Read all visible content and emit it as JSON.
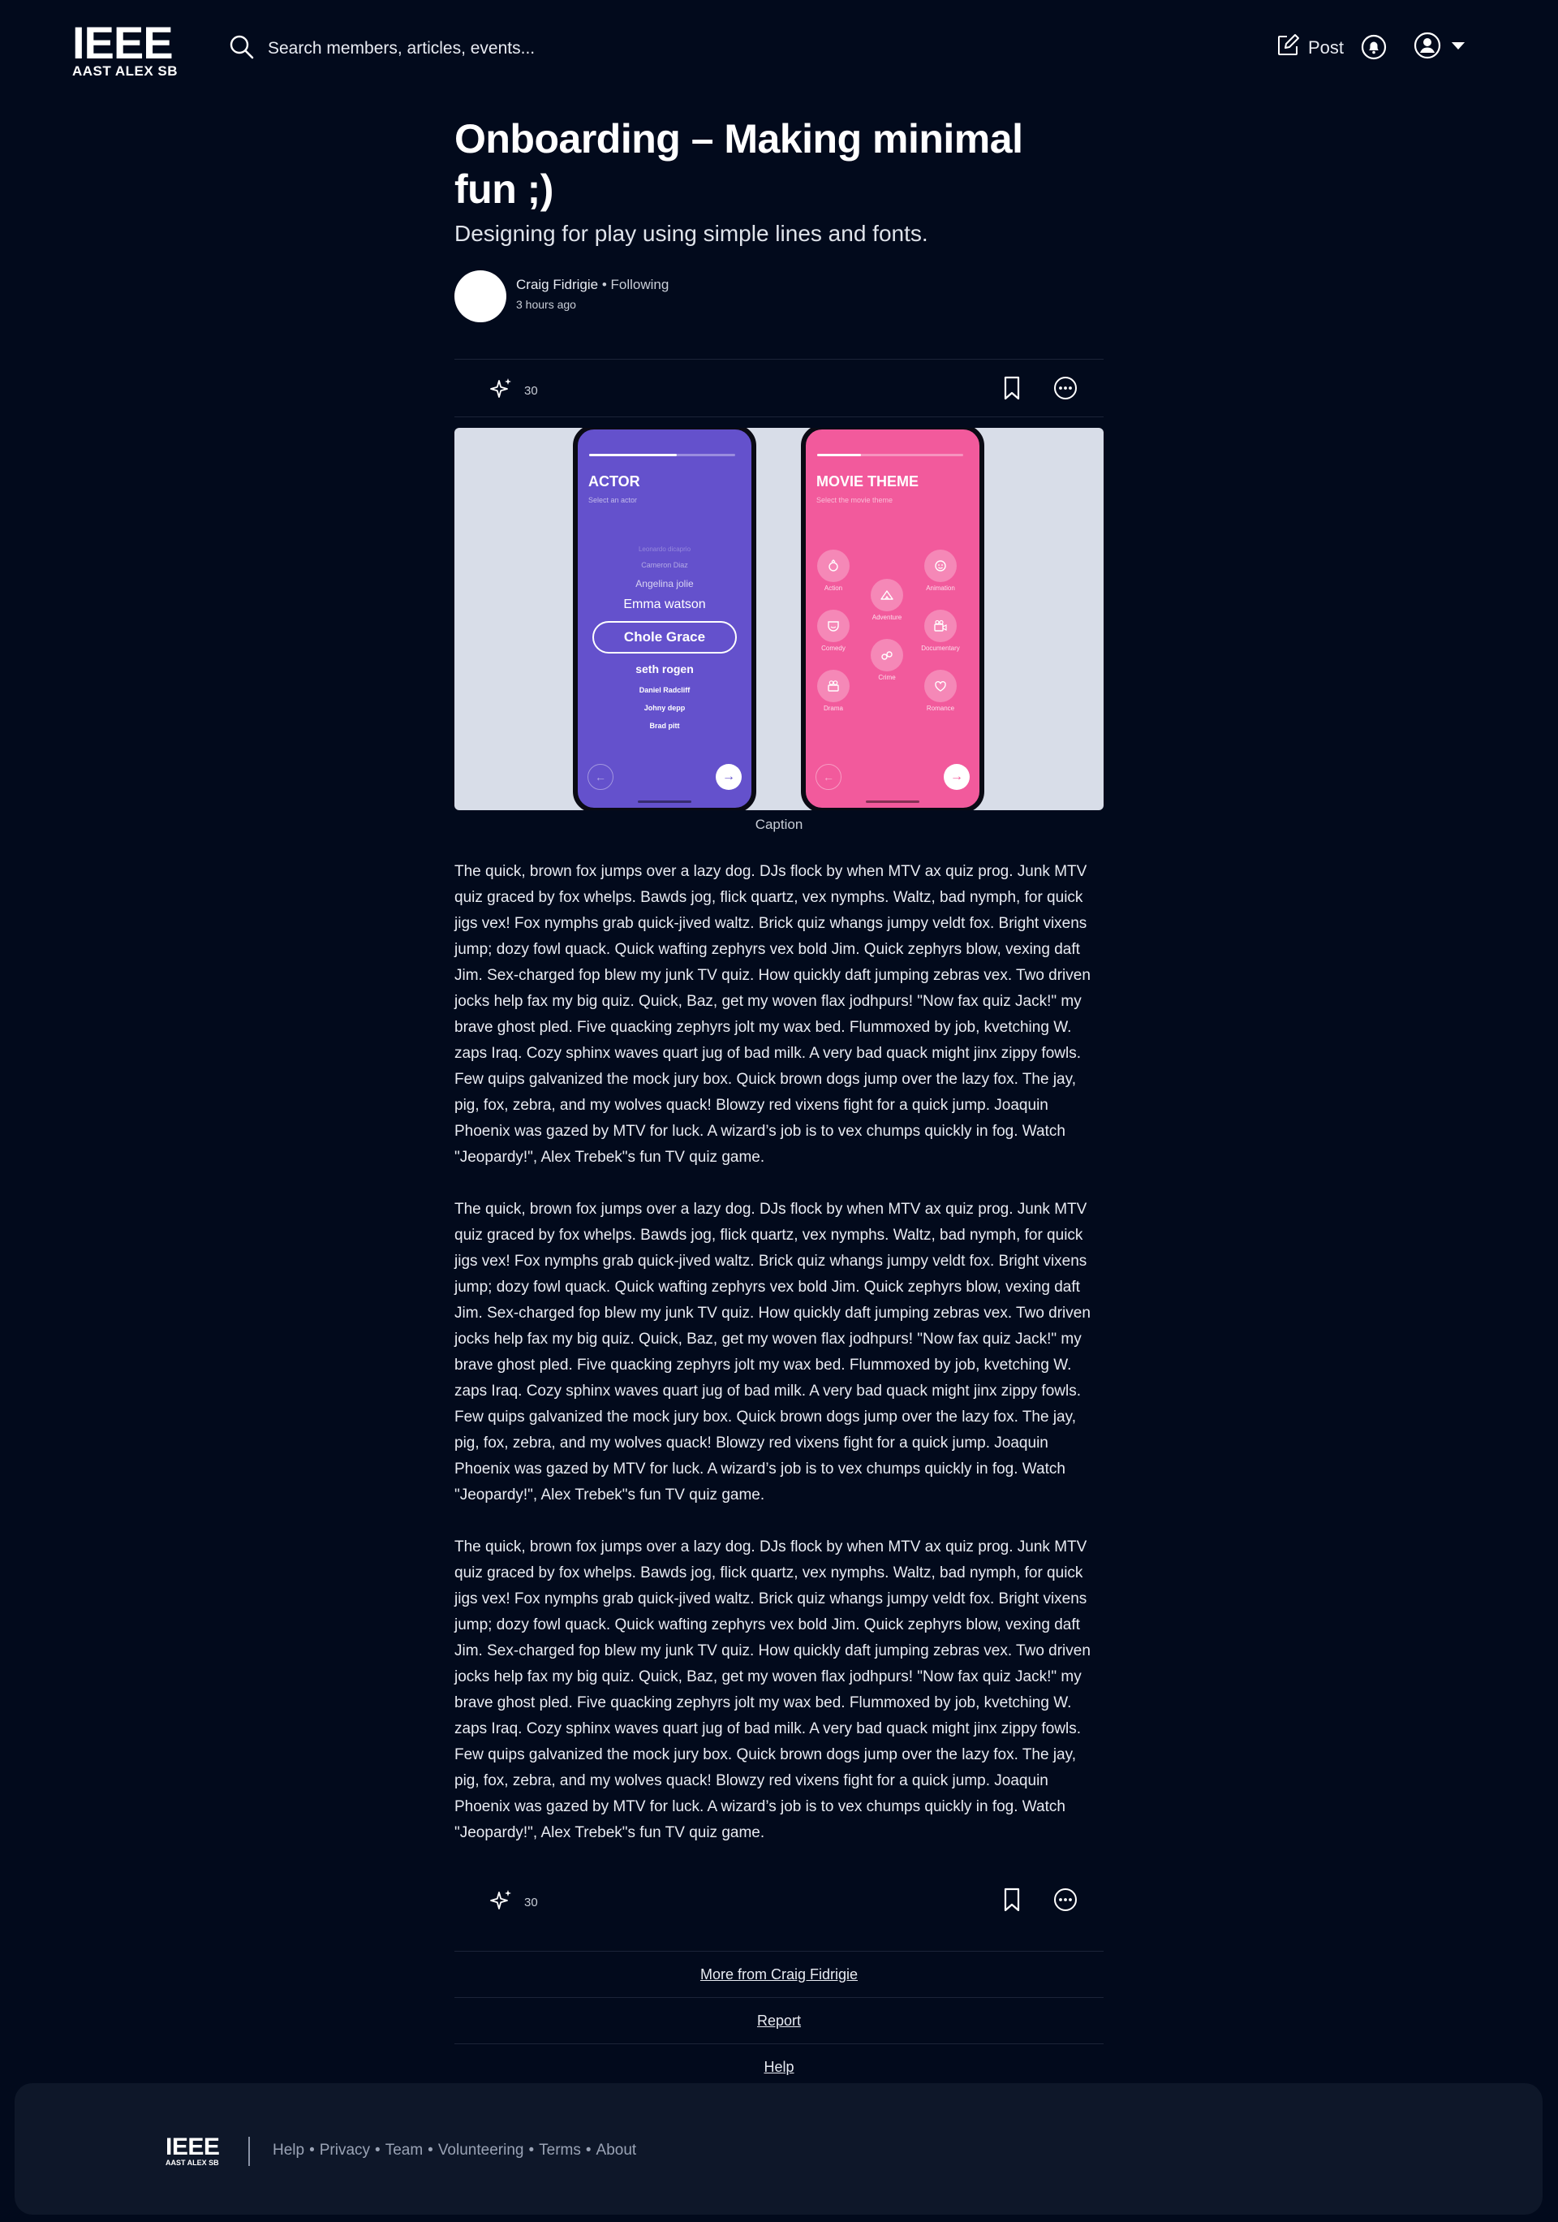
{
  "header": {
    "logo_main": "IEEE",
    "logo_sub": "AAST ALEX SB",
    "search_placeholder": "Search members, articles, events...",
    "post_label": "Post"
  },
  "article": {
    "title": "Onboarding – Making minimal fun ;)",
    "subtitle": "Designing for play using simple lines and fonts.",
    "author": "Craig Fidrigie",
    "following": "• Following",
    "time": "3 hours ago",
    "claps": "30",
    "caption": "Caption",
    "paragraphs": [
      "The quick, brown fox jumps over a lazy dog. DJs flock by when MTV ax quiz prog. Junk MTV quiz graced by fox whelps. Bawds jog, flick quartz, vex nymphs. Waltz, bad nymph, for quick jigs vex! Fox nymphs grab quick-jived waltz. Brick quiz whangs jumpy veldt fox. Bright vixens jump; dozy fowl quack. Quick wafting zephyrs vex bold Jim. Quick zephyrs blow, vexing daft Jim. Sex-charged fop blew my junk TV quiz. How quickly daft jumping zebras vex. Two driven jocks help fax my big quiz. Quick, Baz, get my woven flax jodhpurs! \"Now fax quiz Jack!\" my brave ghost pled. Five quacking zephyrs jolt my wax bed. Flummoxed by job, kvetching W. zaps Iraq. Cozy sphinx waves quart jug of bad milk. A very bad quack might jinx zippy fowls. Few quips galvanized the mock jury box. Quick brown dogs jump over the lazy fox. The jay, pig, fox, zebra, and my wolves quack! Blowzy red vixens fight for a quick jump. Joaquin Phoenix was gazed by MTV for luck. A wizard’s job is to vex chumps quickly in fog. Watch \"Jeopardy!\", Alex Trebek\"s fun TV quiz game.",
      "The quick, brown fox jumps over a lazy dog. DJs flock by when MTV ax quiz prog. Junk MTV quiz graced by fox whelps. Bawds jog, flick quartz, vex nymphs. Waltz, bad nymph, for quick jigs vex! Fox nymphs grab quick-jived waltz. Brick quiz whangs jumpy veldt fox. Bright vixens jump; dozy fowl quack. Quick wafting zephyrs vex bold Jim. Quick zephyrs blow, vexing daft Jim. Sex-charged fop blew my junk TV quiz. How quickly daft jumping zebras vex. Two driven jocks help fax my big quiz. Quick, Baz, get my woven flax jodhpurs! \"Now fax quiz Jack!\" my brave ghost pled. Five quacking zephyrs jolt my wax bed. Flummoxed by job, kvetching W. zaps Iraq. Cozy sphinx waves quart jug of bad milk. A very bad quack might jinx zippy fowls. Few quips galvanized the mock jury box. Quick brown dogs jump over the lazy fox. The jay, pig, fox, zebra, and my wolves quack! Blowzy red vixens fight for a quick jump. Joaquin Phoenix was gazed by MTV for luck. A wizard’s job is to vex chumps quickly in fog. Watch \"Jeopardy!\", Alex Trebek\"s fun TV quiz game.",
      "The quick, brown fox jumps over a lazy dog. DJs flock by when MTV ax quiz prog. Junk MTV quiz graced by fox whelps. Bawds jog, flick quartz, vex nymphs. Waltz, bad nymph, for quick jigs vex! Fox nymphs grab quick-jived waltz. Brick quiz whangs jumpy veldt fox. Bright vixens jump; dozy fowl quack. Quick wafting zephyrs vex bold Jim. Quick zephyrs blow, vexing daft Jim. Sex-charged fop blew my junk TV quiz. How quickly daft jumping zebras vex. Two driven jocks help fax my big quiz. Quick, Baz, get my woven flax jodhpurs! \"Now fax quiz Jack!\" my brave ghost pled. Five quacking zephyrs jolt my wax bed. Flummoxed by job, kvetching W. zaps Iraq. Cozy sphinx waves quart jug of bad milk. A very bad quack might jinx zippy fowls. Few quips galvanized the mock jury box. Quick brown dogs jump over the lazy fox. The jay, pig, fox, zebra, and my wolves quack! Blowzy red vixens fight for a quick jump. Joaquin Phoenix was gazed by MTV for luck. A wizard’s job is to vex chumps quickly in fog. Watch \"Jeopardy!\", Alex Trebek\"s fun TV quiz game."
    ]
  },
  "figure": {
    "actor_screen": {
      "title": "ACTOR",
      "subtitle": "Select an actor",
      "progress": 0.6,
      "names": [
        "Leonardo dicaprio",
        "Cameron Diaz",
        "Angelina jolie",
        "Emma watson",
        "Chole Grace",
        "seth rogen",
        "Daniel Radcliff",
        "Johny depp",
        "Brad pitt"
      ]
    },
    "movie_screen": {
      "title": "MOVIE THEME",
      "subtitle": "Select the movie theme",
      "progress": 0.3,
      "genres": [
        "Action",
        "Adventure",
        "Animation",
        "Comedy",
        "Crime",
        "Documentary",
        "Drama",
        "Romance"
      ]
    }
  },
  "links": {
    "more_from": "More from Craig Fidrigie",
    "report": "Report",
    "help": "Help"
  },
  "footer": {
    "logo_main": "IEEE",
    "logo_sub": "AAST ALEX SB",
    "items": [
      "Help",
      "Privacy",
      "Team",
      "Volunteering",
      "Terms",
      "About"
    ],
    "separator": "•"
  },
  "colors": {
    "background": "#020a1c",
    "footer_bg": "#0e1729",
    "actor_screen": "#6451cc",
    "movie_screen": "#f25a9c",
    "figure_bg": "#d8dde8"
  },
  "icons": [
    "search-icon",
    "post-edit-icon",
    "notification-bell-icon",
    "account-icon",
    "chevron-down-icon",
    "clap-sparkle-icon",
    "bookmark-icon",
    "more-options-icon"
  ]
}
